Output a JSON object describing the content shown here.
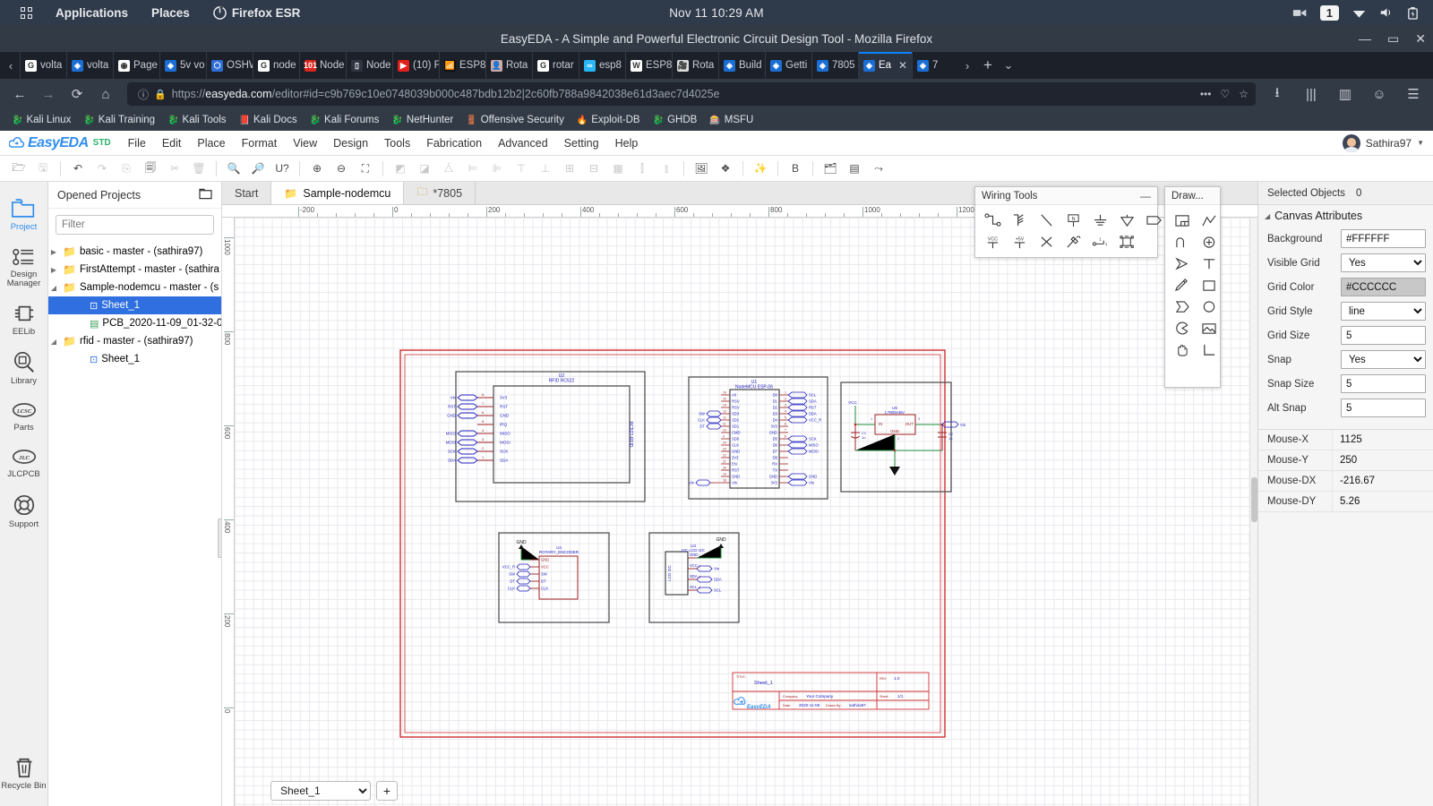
{
  "gnome": {
    "apps_label": "Applications",
    "places_label": "Places",
    "app_label": "Firefox ESR",
    "clock": "Nov 11  10:29 AM",
    "workspace": "1",
    "icons": [
      "camera-icon",
      "wifi-icon",
      "volume-icon",
      "battery-icon"
    ]
  },
  "firefox": {
    "window_title": "EasyEDA - A Simple and Powerful Electronic Circuit Design Tool - Mozilla Firefox",
    "window_buttons": [
      "minimize",
      "maximize",
      "close"
    ],
    "tabs": [
      {
        "label": "volta",
        "favicon": "google",
        "active": false
      },
      {
        "label": "volta",
        "favicon": "easyeda",
        "active": false
      },
      {
        "label": "Page",
        "favicon": "generic",
        "active": false
      },
      {
        "label": "5v vo",
        "favicon": "easyeda",
        "active": false
      },
      {
        "label": "OSHW",
        "favicon": "oshw",
        "active": false
      },
      {
        "label": "node",
        "favicon": "google",
        "active": false
      },
      {
        "label": "Node",
        "favicon": "instructables",
        "active": false
      },
      {
        "label": "Node",
        "favicon": "chip",
        "active": false
      },
      {
        "label": "(10) F",
        "favicon": "youtube",
        "active": false
      },
      {
        "label": "ESP8",
        "favicon": "rss",
        "active": false
      },
      {
        "label": "Rota",
        "favicon": "person",
        "active": false
      },
      {
        "label": "rotar",
        "favicon": "google",
        "active": false
      },
      {
        "label": "esp8",
        "favicon": "forum",
        "active": false
      },
      {
        "label": "ESP8",
        "favicon": "wordpress",
        "active": false
      },
      {
        "label": "Rota",
        "favicon": "video",
        "active": false
      },
      {
        "label": "Build",
        "favicon": "blue",
        "active": false
      },
      {
        "label": "Getti",
        "favicon": "blue",
        "active": false
      },
      {
        "label": "7805",
        "favicon": "easyeda",
        "active": false
      },
      {
        "label": "Ea",
        "favicon": "easyeda",
        "active": true
      },
      {
        "label": "7",
        "favicon": "easyeda",
        "active": false
      }
    ],
    "url_scheme": "https://",
    "url_host": "easyeda.com",
    "url_path": "/editor#id=c9b769c10e0748039b000c487bdb12b2|2c60fb788a9842038e61d3aec7d4025e",
    "url_full": "https://easyeda.com/editor#id=c9b769c10e0748039b000c487bdb12b2|2c60fb788a9842038e61d3aec7d4025e",
    "bookmarks": [
      {
        "label": "Kali Linux",
        "icon": "dragon-icon"
      },
      {
        "label": "Kali Training",
        "icon": "dragon-icon"
      },
      {
        "label": "Kali Tools",
        "icon": "dragon-icon"
      },
      {
        "label": "Kali Docs",
        "icon": "book-icon"
      },
      {
        "label": "Kali Forums",
        "icon": "dragon-icon"
      },
      {
        "label": "NetHunter",
        "icon": "dragon-icon"
      },
      {
        "label": "Offensive Security",
        "icon": "gate-icon"
      },
      {
        "label": "Exploit-DB",
        "icon": "exploit-icon"
      },
      {
        "label": "GHDB",
        "icon": "dragon-icon"
      },
      {
        "label": "MSFU",
        "icon": "msf-icon"
      }
    ]
  },
  "eda": {
    "brand": "EasyEDA",
    "edition": "STD",
    "menu": [
      "File",
      "Edit",
      "Place",
      "Format",
      "View",
      "Design",
      "Tools",
      "Fabrication",
      "Advanced",
      "Setting",
      "Help"
    ],
    "user": "Sathira97",
    "toolbar_icons": [
      "open-icon",
      "save-icon",
      "sep",
      "undo-icon",
      "redo-icon",
      "copy-icon",
      "paste-icon",
      "cut-icon",
      "delete-icon",
      "sep",
      "search-icon",
      "find-replace-icon",
      "measure-icon",
      "sep",
      "zoom-in-icon",
      "zoom-out-icon",
      "zoom-fit-icon",
      "sep",
      "flip-h-icon",
      "flip-v-icon",
      "mirror-icon",
      "align-left-icon",
      "align-right-icon",
      "align-top-icon",
      "align-bottom-icon",
      "align-center-h-icon",
      "align-center-v-icon",
      "grid-icon",
      "distribute-h-icon",
      "distribute-v-icon",
      "sep",
      "image-icon",
      "layers-stack-icon",
      "sep",
      "wand-icon",
      "sep",
      "bom-icon",
      "sep",
      "import-icon",
      "layers-icon",
      "share-icon"
    ],
    "rail": [
      {
        "label": "Project",
        "icon": "folder-icon",
        "active": true
      },
      {
        "label": "Design Manager",
        "icon": "list-icon",
        "active": false
      },
      {
        "label": "EELib",
        "icon": "chip-icon",
        "active": false
      },
      {
        "label": "Library",
        "icon": "library-search-icon",
        "active": false
      },
      {
        "label": "Parts",
        "icon": "lcsc-icon",
        "active": false
      },
      {
        "label": "JLCPCB",
        "icon": "jlc-icon",
        "active": false
      },
      {
        "label": "Support",
        "icon": "lifebuoy-icon",
        "active": false
      },
      {
        "label": "Recycle Bin",
        "icon": "trash-icon",
        "active": false
      }
    ],
    "project_panel": {
      "title": "Opened Projects",
      "filter_placeholder": "Filter",
      "filter_value": "",
      "tree": [
        {
          "label": "basic - master - (sathira97)",
          "type": "folder",
          "indent": 0,
          "twisty": "collapsed",
          "selected": false
        },
        {
          "label": "FirstAttempt - master - (sathira",
          "type": "folder",
          "indent": 0,
          "twisty": "collapsed",
          "selected": false
        },
        {
          "label": "Sample-nodemcu - master - (s",
          "type": "folder-open",
          "indent": 0,
          "twisty": "expanded",
          "selected": false
        },
        {
          "label": "Sheet_1",
          "type": "schematic",
          "indent": 2,
          "twisty": "none",
          "selected": true
        },
        {
          "label": "PCB_2020-11-09_01-32-07",
          "type": "pcb",
          "indent": 2,
          "twisty": "none",
          "selected": false
        },
        {
          "label": "rfid - master - (sathira97)",
          "type": "folder-open",
          "indent": 0,
          "twisty": "expanded",
          "selected": false
        },
        {
          "label": "Sheet_1",
          "type": "schematic",
          "indent": 2,
          "twisty": "none",
          "selected": false
        }
      ]
    },
    "doc_tabs": [
      {
        "label": "Start",
        "icon": "none",
        "active": false
      },
      {
        "label": "Sample-nodemcu",
        "icon": "folder-filled",
        "active": true
      },
      {
        "label": "*7805",
        "icon": "folder-hollow",
        "active": false
      }
    ],
    "ruler_h_labels": [
      "-200",
      "0",
      "200",
      "400",
      "600",
      "800",
      "1000",
      "1200"
    ],
    "ruler_v_labels": [
      "1000",
      "800",
      "600",
      "400",
      "200",
      "0"
    ],
    "sheet_selector": {
      "value": "Sheet_1",
      "options": [
        "Sheet_1"
      ]
    },
    "add_sheet_label": "+",
    "palettes": [
      {
        "title": "Wiring Tools",
        "minimize": "—",
        "tools": [
          "wire-icon",
          "bus-icon",
          "bus-entry-icon",
          "netlabel-icon",
          "netport-icon",
          "ground-icon",
          "vcc-flag-icon",
          "vcc-icon",
          "plus5v-icon",
          "no-connect-icon",
          "netflag-icon",
          "pin-icon",
          "part-icon"
        ]
      },
      {
        "title": "Draw...",
        "minimize": "—",
        "tools": [
          "canvas-icon",
          "polyline-icon",
          "arc-icon",
          "circle-plus-icon",
          "arrow-icon",
          "text-icon",
          "pencil-icon",
          "rect-icon",
          "polygon-icon",
          "ellipse-icon",
          "pie-icon",
          "image-icon",
          "hand-icon",
          "corner-icon"
        ]
      }
    ],
    "right_panel": {
      "selected_objects_label": "Selected Objects",
      "selected_objects_count": "0",
      "canvas_attributes_title": "Canvas Attributes",
      "attributes": [
        {
          "label": "Background",
          "value": "#FFFFFF",
          "type": "text"
        },
        {
          "label": "Visible Grid",
          "value": "Yes",
          "type": "select",
          "options": [
            "Yes",
            "No"
          ]
        },
        {
          "label": "Grid Color",
          "value": "#CCCCCC",
          "type": "color"
        },
        {
          "label": "Grid Style",
          "value": "line",
          "type": "select",
          "options": [
            "line",
            "dot"
          ]
        },
        {
          "label": "Grid Size",
          "value": "5",
          "type": "text"
        },
        {
          "label": "Snap",
          "value": "Yes",
          "type": "select",
          "options": [
            "Yes",
            "No"
          ]
        },
        {
          "label": "Snap Size",
          "value": "5",
          "type": "text"
        },
        {
          "label": "Alt Snap",
          "value": "5",
          "type": "text"
        }
      ],
      "mouse": [
        {
          "key": "Mouse-X",
          "value": "1125"
        },
        {
          "key": "Mouse-Y",
          "value": "250"
        },
        {
          "key": "Mouse-DX",
          "value": "-216.67"
        },
        {
          "key": "Mouse-DY",
          "value": "5.26"
        }
      ]
    },
    "schematic": {
      "title_block": {
        "title_label": "TITLE:",
        "title_value": "Sheet_1",
        "rev_label": "REV:",
        "rev_value": "1.0",
        "company_label": "Company:",
        "company_value": "Your Company",
        "sheet_label": "Sheet:",
        "sheet_value": "1/1",
        "date_label": "Date:",
        "date_value": "2020-11-08",
        "drawn_label": "Drawn By:",
        "drawn_value": "sathira97",
        "logo": "EasyEDA"
      },
      "components": [
        {
          "designator": "U2",
          "name": "RFID RC522",
          "side_text": "RC522-RFID",
          "left_pins": [
            "Vin",
            "RST",
            "GND",
            "",
            "MISO",
            "MOSI",
            "SCK",
            "SDA"
          ],
          "pin_numbers": [
            "8",
            "7",
            "6",
            "5",
            "4",
            "3",
            "2",
            "1"
          ],
          "inner_pins": [
            "3V3",
            "RST",
            "GND",
            "IRQ",
            "MISO",
            "MOSI",
            "SCK",
            "SDA"
          ]
        },
        {
          "designator": "U1",
          "name": "NodeMCU ESP-06",
          "left_numbers": [
            "16",
            "15",
            "14",
            "13",
            "12",
            "11",
            "10",
            "9",
            "24",
            "23",
            "22",
            "21",
            "20",
            "19",
            "18",
            "17"
          ],
          "left_inner": [
            "A0",
            "RSV",
            "RSV",
            "SD3",
            "SD2",
            "SD1",
            "CMD",
            "SD0",
            "CLK",
            "GND",
            "3V3",
            "EN",
            "RST",
            "GND",
            "Vin"
          ],
          "right_inner": [
            "D0",
            "D1",
            "D2",
            "D3",
            "D4",
            "3V3",
            "GND",
            "D5",
            "D6",
            "D7",
            "D8",
            "RX",
            "TX",
            "GND",
            "3V3"
          ],
          "right_numbers": [
            "1",
            "2",
            "3",
            "4",
            "5",
            "6",
            "7",
            "8"
          ],
          "left_net_labels": [
            "SW",
            "CLK",
            "DT",
            "Vin"
          ],
          "right_net_labels": [
            "SCL",
            "SDA",
            "RST",
            "SDA",
            "VCC_R",
            "SCK",
            "MISO",
            "MOSI",
            "GND",
            "Vin"
          ]
        },
        {
          "designator": "U6",
          "name": "L7805ABV",
          "pins": [
            "IN",
            "OUT",
            "GND"
          ],
          "pin_numbers": [
            "1",
            "3",
            "2"
          ],
          "nets": [
            "VCC",
            "Vin"
          ],
          "passives": [
            {
              "designator": "C1",
              "value": "1u"
            },
            {
              "designator": "C2",
              "value": "1u"
            }
          ]
        },
        {
          "designator": "U4",
          "name": "ROTARY_ENCODER",
          "gnd_label": "GND",
          "pins": [
            "GND",
            "VCC",
            "SW",
            "DT",
            "CLK"
          ],
          "net_labels": [
            "VCC_R",
            "SW",
            "DT",
            "CLK"
          ]
        },
        {
          "designator": "U3",
          "name": "I2C LCD I2C",
          "side_text": "LCD I2C",
          "gnd_label": "GND",
          "pins": [
            "GND",
            "VCC",
            "SDA",
            "SCL"
          ],
          "pin_numbers": [
            "1",
            "2",
            "3",
            "4"
          ],
          "net_labels": [
            "Vin",
            "SDA",
            "SCL"
          ]
        }
      ]
    }
  }
}
